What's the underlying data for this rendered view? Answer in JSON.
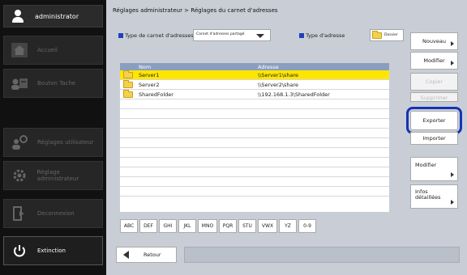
{
  "sidebar": {
    "user": "administrator",
    "items": [
      {
        "label": "Accueil",
        "icon": "home-icon"
      },
      {
        "label": "Bouton Tache",
        "icon": "task-icon"
      },
      {
        "label": "Réglages utilisateur",
        "icon": "user-settings-icon"
      },
      {
        "label": "Réglage administrateur",
        "icon": "admin-settings-icon"
      },
      {
        "label": "Deconnexion",
        "icon": "logout-icon"
      },
      {
        "label": "Extinction",
        "icon": "power-icon"
      }
    ]
  },
  "main": {
    "breadcrumb": "Réglages administrateur > Réglages du carnet d'adresses",
    "address_book_type_label": "Type de carnet d'adresses",
    "address_book_type_value": "Carnet d'adresses partagé",
    "address_type_label": "Type d'adresse",
    "address_type_value": "Dossier",
    "table": {
      "columns": [
        "Nom",
        "Adresse"
      ],
      "rows": [
        {
          "name": "Server1",
          "address": "\\\\Server1\\share",
          "selected": true
        },
        {
          "name": "Server2",
          "address": "\\\\Server2\\share",
          "selected": false
        },
        {
          "name": "SharedFolder",
          "address": "\\\\192.168.1.3\\SharedFolder",
          "selected": false
        }
      ]
    },
    "alpha_tabs": [
      "ABC",
      "DEF",
      "GHI",
      "JKL",
      "MNO",
      "PQR",
      "STU",
      "VWX",
      "YZ",
      "0-9"
    ],
    "back_label": "Retour"
  },
  "actions": {
    "nouveau": "Nouveau",
    "modifier": "Modifier",
    "copier": "Copier",
    "supprimer": "Supprimer",
    "exporter": "Exporter",
    "importer": "Importer",
    "modifier2": "Modifier",
    "infos": "Infos détaillées"
  },
  "colors": {
    "selected_row": "#ffe600",
    "highlight_outline": "#1633b6",
    "table_header": "#8a9fbf"
  }
}
